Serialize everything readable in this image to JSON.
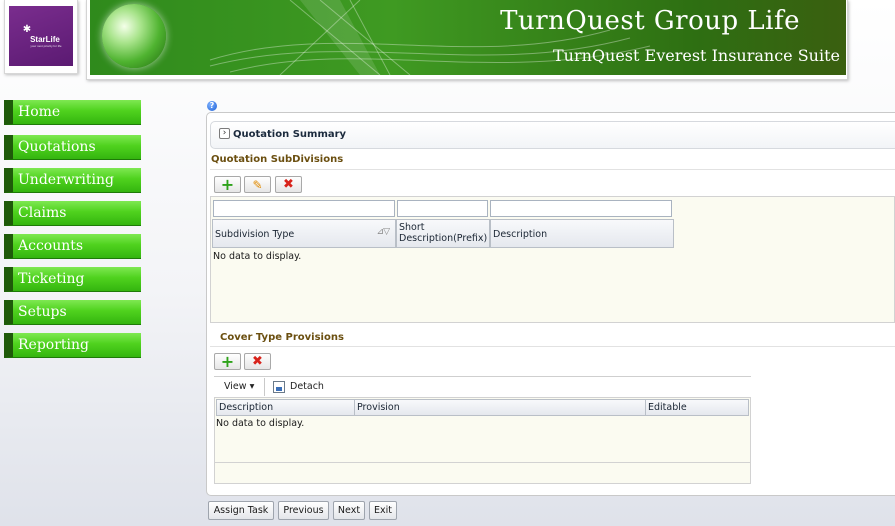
{
  "header": {
    "logo_name": "StarLife",
    "logo_tagline": "your next priority for life",
    "title": "TurnQuest Group Life",
    "subtitle": "TurnQuest Everest Insurance Suite"
  },
  "sidebar": {
    "items": [
      {
        "label": "Home"
      },
      {
        "label": "Quotations"
      },
      {
        "label": "Underwriting"
      },
      {
        "label": "Claims"
      },
      {
        "label": "Accounts"
      },
      {
        "label": "Ticketing"
      },
      {
        "label": "Setups"
      },
      {
        "label": "Reporting"
      }
    ]
  },
  "help_icon": "?",
  "quotation_summary": {
    "title": "Quotation Summary",
    "disclose_icon": "chevron-right-icon"
  },
  "subdivisions": {
    "title": "Quotation SubDivisions",
    "columns": [
      "Subdivision Type",
      "Short Description(Prefix)",
      "Description"
    ],
    "short_desc_line1": "Short",
    "short_desc_line2": "Description(Prefix)",
    "empty_text": "No data to display."
  },
  "cover_provisions": {
    "title": "Cover Type Provisions",
    "view_label": "View ▾",
    "detach_label": "Detach",
    "columns": [
      "Description",
      "Provision",
      "Editable"
    ],
    "empty_text": "No data to display."
  },
  "footer": {
    "assign_task": "Assign Task",
    "previous": "Previous",
    "next": "Next",
    "exit": "Exit"
  },
  "colors": {
    "nav_green": "#4fd21e",
    "banner_green": "#2f8a1c",
    "section_title": "#6b4f10",
    "logo_purple": "#6a2381"
  }
}
